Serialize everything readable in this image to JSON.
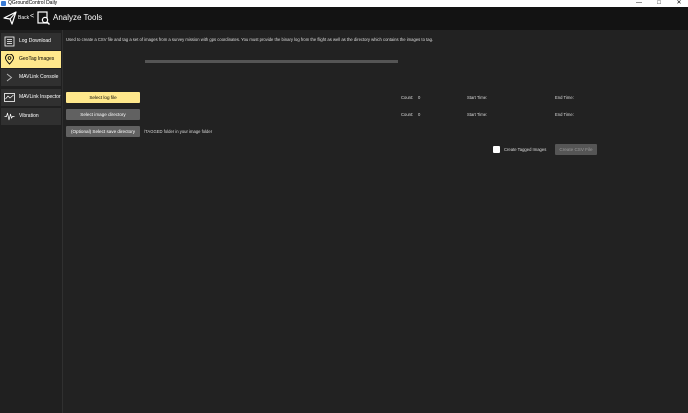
{
  "window": {
    "title": "QGroundControl Daily",
    "minimize_glyph": "—",
    "maximize_glyph": "□",
    "close_glyph": "✕"
  },
  "header": {
    "back_label": "Back",
    "back_chevron": "<",
    "page_title": "Analyze Tools"
  },
  "sidebar": {
    "items": [
      {
        "label": "Log Download",
        "icon": "log-download-icon"
      },
      {
        "label": "GeoTag Images",
        "icon": "geotag-pin-icon",
        "active": true
      },
      {
        "label": "MAVLink Console",
        "icon": "console-chevron-icon"
      },
      {
        "label": "MAVLink Inspector",
        "icon": "inspector-icon"
      },
      {
        "label": "Vibration",
        "icon": "vibration-wave-icon"
      }
    ]
  },
  "geotag": {
    "description": "Used to create a CSV file and tag a set of images from a survey mission with gps coordinates. You must provide the binary log from the flight as well as the directory which contains the images to tag.",
    "progress": 0,
    "select_log_button": "Select log file",
    "select_image_dir_button": "Select image directory",
    "select_save_dir_button": "(Optional) Select save directory",
    "save_dir_hint": "/TAGGED folder in your image folder",
    "log_row": {
      "count_label": "Count:",
      "count_value": "0",
      "start_label": "Start Time:",
      "end_label": "End Time:"
    },
    "image_row": {
      "count_label": "Count:",
      "count_value": "0",
      "start_label": "Start Time:",
      "end_label": "End Time:"
    },
    "create_tagged_label": "Create Tagged Images",
    "create_tagged_checked": false,
    "create_csv_button": "Create CSV File"
  },
  "colors": {
    "accent_yellow": "#ffe88c",
    "background": "#222222",
    "toolbar": "#131313",
    "button_gray": "#616161"
  }
}
